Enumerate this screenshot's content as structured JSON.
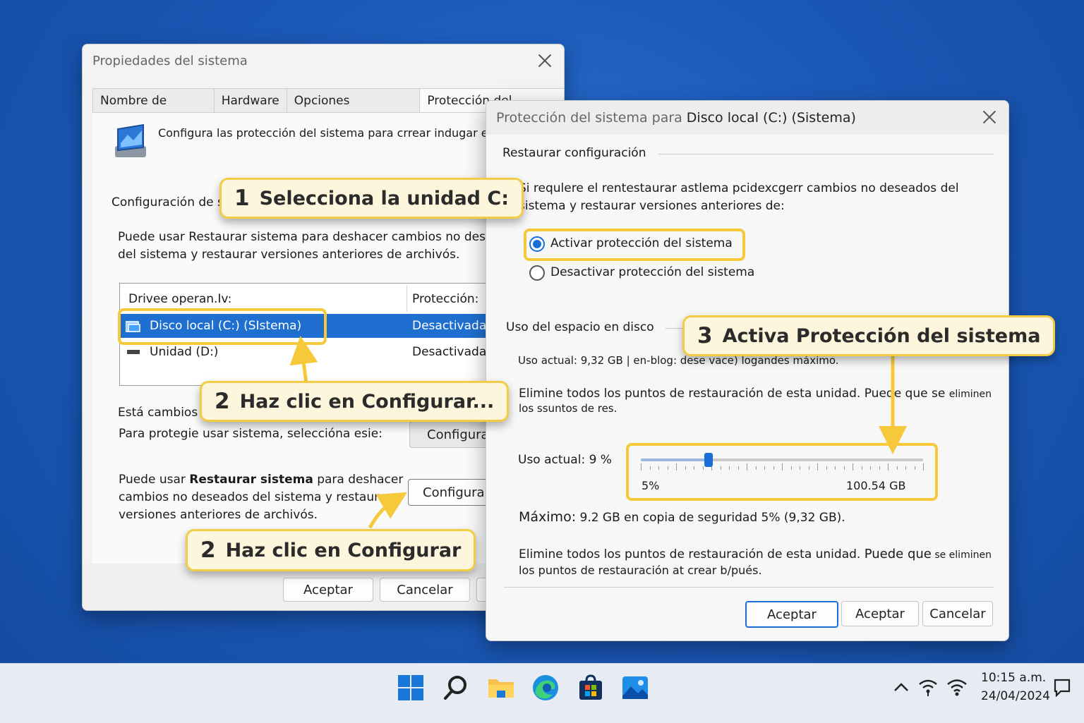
{
  "window1": {
    "title": "Propiedades del sistema",
    "tabs": [
      "Nombre de equipo",
      "Hardware",
      "Opciones avanzadas",
      "Protección del sistema"
    ],
    "intro": "Configura las protección del sistema para crrear indugar e",
    "section_label": "Configuración de s",
    "desc_line1": "Puede usar Restaurar sistema para deshacer cambios no deseán",
    "desc_line2": "del sistema y restaurar versiones anteriores de archivós.",
    "table": {
      "col_drives": "Drivee operan.Iv:",
      "col_protection": "Protección:",
      "rows": [
        {
          "name": "Disco local  (C:)  (SIstema)",
          "status": "Desactivada"
        },
        {
          "name": "Unidad (D:)",
          "status": "Desactivada"
        }
      ]
    },
    "changes_label": "Está cambios (",
    "protect_text": "Para protegie usar sistema, seleccióna esie:",
    "configure_btn1": "Configurar",
    "restore_p1": "Puede usar ",
    "restore_bold": "Restaurar sistema",
    "restore_p2": " para deshacer",
    "restore_line2": "cambios no deseados del sistema y restaurar",
    "restore_line3": "versiones anteriores de archivós.",
    "configure_btn2": "Configurar",
    "ok_btn": "Aceptar",
    "cancel_btn": "Cancelar"
  },
  "window2": {
    "title_prefix": "Protección del sistema para ",
    "title_drive": "Disco local (C:) (Sistema)",
    "restore_group": "Restaurar configuración",
    "restore_desc1": "Si requlere el rentestaurar astlema pcidexcgerr cambios no deseados del",
    "restore_desc2": "sistema y restaurar versiones anteriores de:",
    "radio_on": "Activar protección del sistema",
    "radio_off": "Desactivar protección del sistema",
    "disk_group": "Uso del espacio en disco",
    "current_usage": "Uso actual: 9,32 GB | en-blog: dese vace) logandes máximo.",
    "delete_line1a": "Elimine todos los puntos de restauración de esta unidad. Puede que se ",
    "delete_line1b": "eliminen",
    "delete_line2": "los ssuntos de res.",
    "slider_label": "Uso actual: 9 %",
    "slider_level": 0.24,
    "slider_min": "5%",
    "slider_max": "100.54 GB",
    "max_bold": "Máximo:",
    "max_text": " 9.2 GB en copia de seguridad 5% (9,32 GB).",
    "delete2_line1a": "Elimine todos los puntos de restauración de esta unidad. ",
    "delete2_line1b": "Puede que",
    "delete2_line1c": " se eliminen",
    "delete2_line2": "los puntos de restauración at crear b/pués.",
    "btn_ok1": "Aceptar",
    "btn_ok2": "Aceptar",
    "btn_cancel": "Cancelar"
  },
  "callouts": [
    {
      "num": "1",
      "text": "Selecciona la unidad C:"
    },
    {
      "num": "2",
      "text": "Haz clic en Configurar..."
    },
    {
      "num": "2",
      "text": "Haz clic en Configurar"
    },
    {
      "num": "3",
      "text": "Activa Protección del sistema"
    }
  ],
  "taskbar": {
    "icons": [
      "windows-start-icon",
      "search-icon",
      "file-explorer-icon",
      "edge-icon",
      "store-icon",
      "photos-icon"
    ],
    "time": "10:15 a.m.",
    "date": "24/04/2024"
  },
  "colors": {
    "accent": "#1a6fd6",
    "callout_border": "#f2cc45",
    "selection": "#1f6fd0"
  }
}
